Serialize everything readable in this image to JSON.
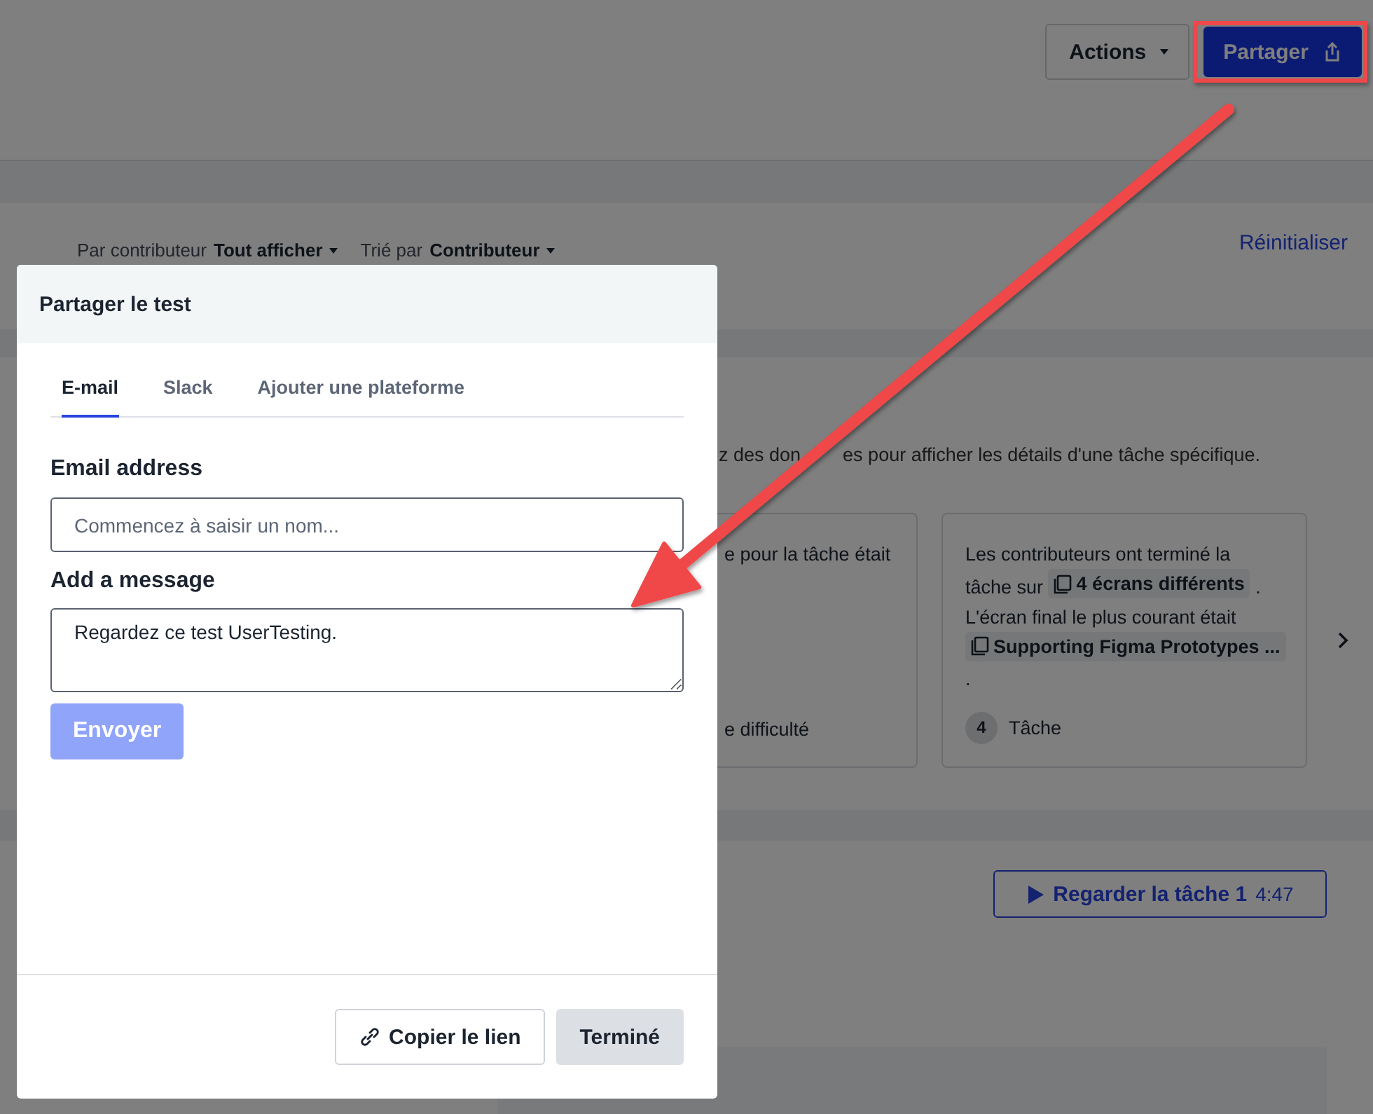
{
  "page": {
    "header_buttons": [
      {
        "label": "Actions",
        "kind": "dropdown"
      },
      {
        "label": "Partager",
        "kind": "share"
      }
    ],
    "filters": [
      {
        "label": "Par contributeur",
        "value": "Tout afficher"
      },
      {
        "label": "Trié par",
        "value": "Contributeur"
      }
    ],
    "reset_link": "Réinitialiser",
    "hint": [
      "z des don",
      "es pour afficher les détails d'une tâche spécifique."
    ],
    "cards": [
      {
        "parts": [
          {
            "kind": "text",
            "text": "e pour la tâche était"
          }
        ],
        "footer": {
          "text": "e difficulté"
        }
      },
      {
        "parts": [
          {
            "kind": "text",
            "text": "Les contributeurs ont terminé la"
          },
          {
            "kind": "break"
          },
          {
            "kind": "text",
            "text": "tâche sur"
          },
          {
            "kind": "chip",
            "text": "4 écrans différents"
          },
          {
            "kind": "text",
            "text": "."
          },
          {
            "kind": "break"
          },
          {
            "kind": "text",
            "text": "L'écran final le plus courant était"
          },
          {
            "kind": "break"
          },
          {
            "kind": "chip",
            "text": "Supporting Figma Prototypes ..."
          },
          {
            "kind": "break"
          },
          {
            "kind": "text",
            "text": "."
          }
        ],
        "footer": {
          "badge": "4",
          "text": "Tâche"
        }
      }
    ],
    "watch_button": {
      "label": "Regarder la tâche 1",
      "duration": "4:47"
    }
  },
  "dialog": {
    "title": "Partager le test",
    "tabs": [
      {
        "label": "E-mail",
        "selected": true
      },
      {
        "label": "Slack",
        "selected": false
      },
      {
        "label": "Ajouter une plateforme",
        "selected": false
      }
    ],
    "email": {
      "label": "Email address",
      "placeholder": "Commencez à saisir un nom..."
    },
    "message": {
      "label": "Add a message",
      "value": "Regardez ce test UserTesting."
    },
    "send_button": {
      "label": "Envoyer",
      "disabled": true
    },
    "footer_buttons": [
      {
        "label": "Copier le lien",
        "kind": "link"
      },
      {
        "label": "Terminé",
        "kind": "secondary"
      }
    ]
  },
  "annotations": {
    "highlight_box": true,
    "arrow": true
  }
}
